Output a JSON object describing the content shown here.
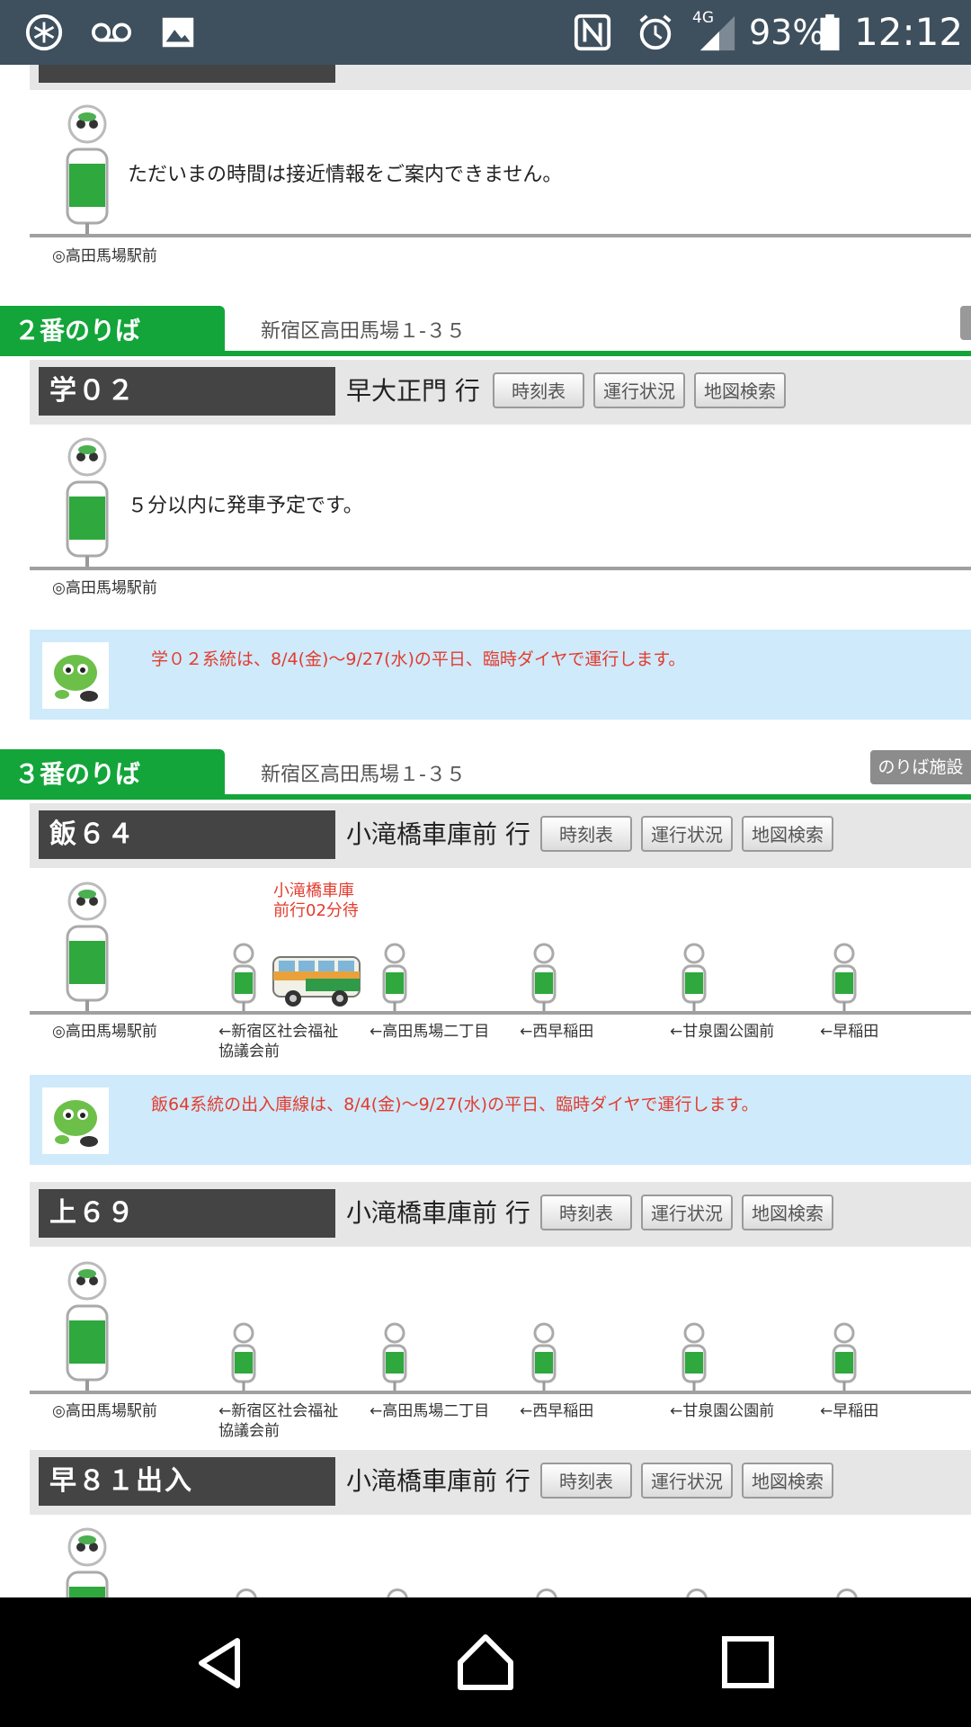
{
  "status_bar": {
    "battery": "93%",
    "network": "4G",
    "time": "12:12",
    "icons": [
      "snowflake-icon",
      "voicemail-icon",
      "image-icon",
      "nfc-icon",
      "alarm-icon",
      "signal-icon",
      "battery-icon"
    ]
  },
  "platforms": [
    {
      "label": "２番のりば",
      "address": "新宿区高田馬場１-３５",
      "routes": [
        {
          "code": "学０２",
          "destination": "早大正門 行",
          "buttons": [
            "時刻表",
            "運行状況",
            "地図検索"
          ],
          "message": "５分以内に発車予定です。",
          "origin": "◎高田馬場駅前"
        }
      ],
      "notice": "学０２系統は、8/4(金)〜9/27(水)の平日、臨時ダイヤで運行します。"
    },
    {
      "label": "３番のりば",
      "address": "新宿区高田馬場１-３５",
      "facility_button": "のりば施設",
      "routes": [
        {
          "code": "飯６４",
          "destination": "小滝橋車庫前 行",
          "buttons": [
            "時刻表",
            "運行状況",
            "地図検索"
          ],
          "bus_status": "小滝橋車庫\n前行02分待",
          "stops": [
            "◎高田馬場駅前",
            "←新宿区社会福祉\n協議会前",
            "←高田馬場二丁目",
            "←西早稲田",
            "←甘泉園公園前",
            "←早稲田"
          ]
        },
        {
          "code": "上６９",
          "destination": "小滝橋車庫前 行",
          "buttons": [
            "時刻表",
            "運行状況",
            "地図検索"
          ],
          "stops": [
            "◎高田馬場駅前",
            "←新宿区社会福祉\n協議会前",
            "←高田馬場二丁目",
            "←西早稲田",
            "←甘泉園公園前",
            "←早稲田"
          ]
        },
        {
          "code": "早８１出入",
          "destination": "小滝橋車庫前 行",
          "buttons": [
            "時刻表",
            "運行状況",
            "地図検索"
          ]
        }
      ],
      "notice": "飯64系統の出入庫線は、8/4(金)〜9/27(水)の平日、臨時ダイヤで運行します。"
    }
  ],
  "top_partial": {
    "message": "ただいまの時間は接近情報をご案内できません。",
    "origin": "◎高田馬場駅前"
  },
  "colors": {
    "accent": "#13a53a",
    "notice_bg": "#cfeafb",
    "notice_text": "#e23c2e"
  }
}
